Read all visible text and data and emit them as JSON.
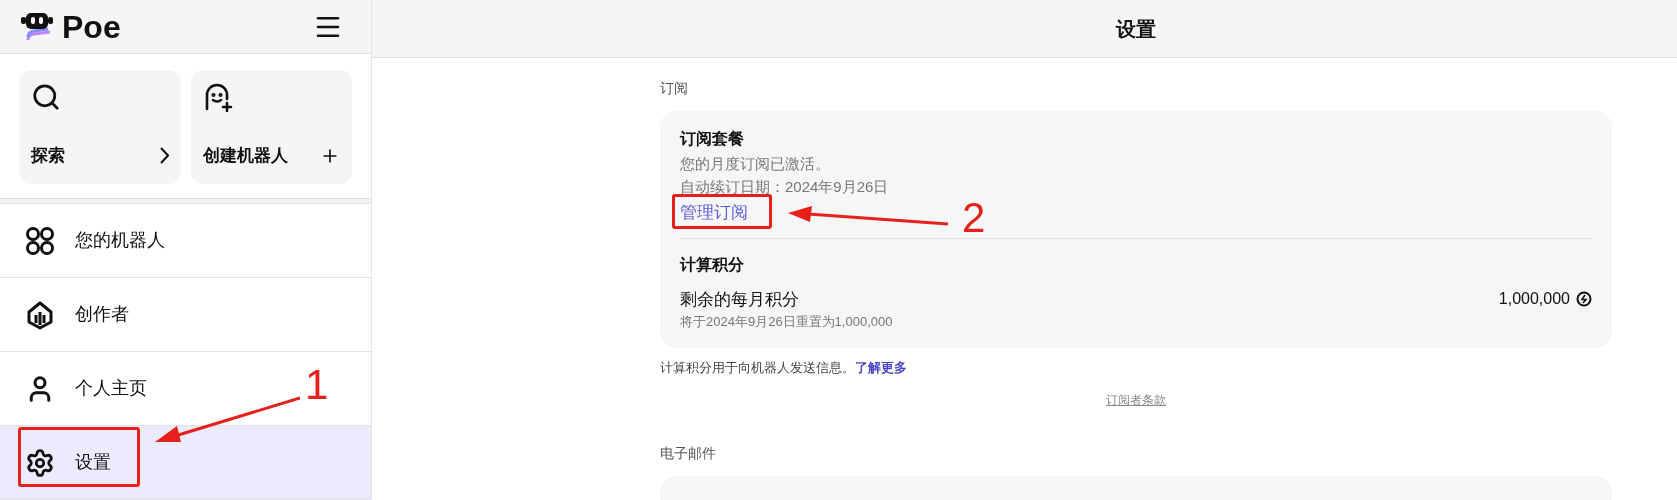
{
  "sidebar": {
    "logo": "Poe",
    "shortcuts": [
      {
        "label": "探索",
        "kind": "explore"
      },
      {
        "label": "创建机器人",
        "kind": "create"
      }
    ],
    "items": [
      {
        "label": "您的机器人",
        "kind": "bots",
        "selected": false
      },
      {
        "label": "创作者",
        "kind": "creator",
        "selected": false
      },
      {
        "label": "个人主页",
        "kind": "profile",
        "selected": false
      },
      {
        "label": "设置",
        "kind": "settings",
        "selected": true
      }
    ]
  },
  "header": {
    "title": "设置"
  },
  "subscription": {
    "heading": "订阅",
    "plan_title": "订阅套餐",
    "status": "您的月度订阅已激活。",
    "renewal": "自动续订日期：2024年9月26日",
    "manage_link": "管理订阅",
    "points_title": "计算积分",
    "points_label": "剩余的每月积分",
    "points_reset": "将于2024年9月26日重置为1,000,000",
    "points_value": "1,000,000"
  },
  "footnote": {
    "text": "计算积分用于向机器人发送信息。",
    "link": "了解更多"
  },
  "terms_link": "订阅者条款",
  "email": {
    "heading": "电子邮件"
  },
  "annotations": [
    {
      "label": "1"
    },
    {
      "label": "2"
    }
  ]
}
